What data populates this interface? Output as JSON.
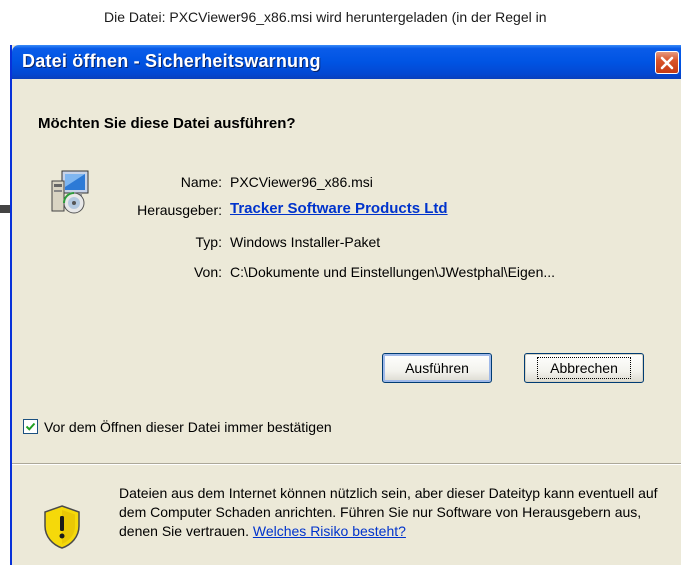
{
  "background": {
    "text_line1": "Die Datei: PXCViewer96_x86.msi wird heruntergeladen (in der Regel in"
  },
  "dialog": {
    "title": "Datei öffnen - Sicherheitswarnung",
    "question": "Möchten Sie diese Datei ausführen?",
    "fields": {
      "name_label": "Name:",
      "name_value": "PXCViewer96_x86.msi",
      "publisher_label": "Herausgeber:",
      "publisher_value": "Tracker Software Products Ltd",
      "type_label": "Typ:",
      "type_value": "Windows Installer-Paket",
      "from_label": "Von:",
      "from_value": "C:\\Dokumente und Einstellungen\\JWestphal\\Eigen..."
    },
    "buttons": {
      "run_label": "Ausführen",
      "cancel_label": "Abbrechen"
    },
    "checkbox": {
      "label": "Vor dem Öffnen dieser Datei immer bestätigen",
      "checked": true
    },
    "warning": {
      "text": "Dateien aus dem Internet können nützlich sein, aber dieser Dateityp kann eventuell auf dem Computer Schaden anrichten. Führen Sie nur Software von Herausgebern aus, denen Sie vertrauen.",
      "link_text": "Welches Risiko besteht?"
    }
  },
  "icons": {
    "app": "installer-icon",
    "close": "close-icon",
    "check": "checkmark-icon",
    "warning": "shield-warning-icon"
  },
  "colors": {
    "titlebar": "#0054e3",
    "dialog_bg": "#ece9d8",
    "link": "#0033cc",
    "close_button": "#d9542b",
    "shield_yellow": "#f5d90a"
  }
}
